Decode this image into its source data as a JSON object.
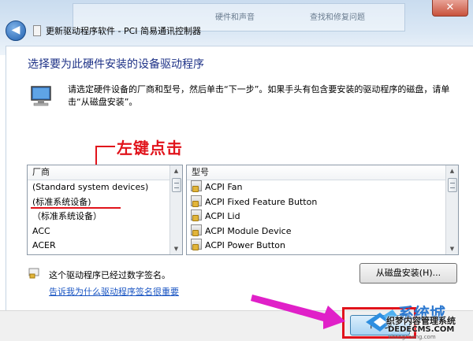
{
  "window": {
    "title": "更新驱动程序软件 - PCI 简易通讯控制器",
    "close_label": "✕",
    "back_label": "◀",
    "background_text_1": "硬件和声音",
    "background_text_2": "查找和修复问题"
  },
  "main": {
    "heading": "选择要为此硬件安装的设备驱动程序",
    "description": "请选定硬件设备的厂商和型号，然后单击“下一步”。如果手头有包含要安装的驱动程序的磁盘，请单击“从磁盘安装”。",
    "annotation": "左键点击"
  },
  "manufacturer_list": {
    "header": "厂商",
    "items": [
      "(Standard system devices)",
      "(标准系统设备)",
      "（标准系统设备）",
      "ACC",
      "ACER"
    ],
    "highlighted_index": 1
  },
  "model_list": {
    "header": "型号",
    "items": [
      "ACPI Fan",
      "ACPI Fixed Feature Button",
      "ACPI Lid",
      "ACPI Module Device",
      "ACPI Power Button"
    ]
  },
  "footer": {
    "signed_text": "这个驱动程序已经过数字签名。",
    "signing_link": "告诉我为什么驱动程序签名很重要",
    "have_disk_button": "从磁盘安装(H)...",
    "next_button": "下一步"
  },
  "watermark": {
    "line1": "系统城",
    "line2": "织梦内容管理系统",
    "line3": "DEDECMS.COM",
    "line4": "xitongcheng.com"
  },
  "colors": {
    "accent_red": "#e1131b",
    "heading_blue": "#1e3287",
    "link_blue": "#1b56c3",
    "arrow_magenta": "#e020c8"
  }
}
